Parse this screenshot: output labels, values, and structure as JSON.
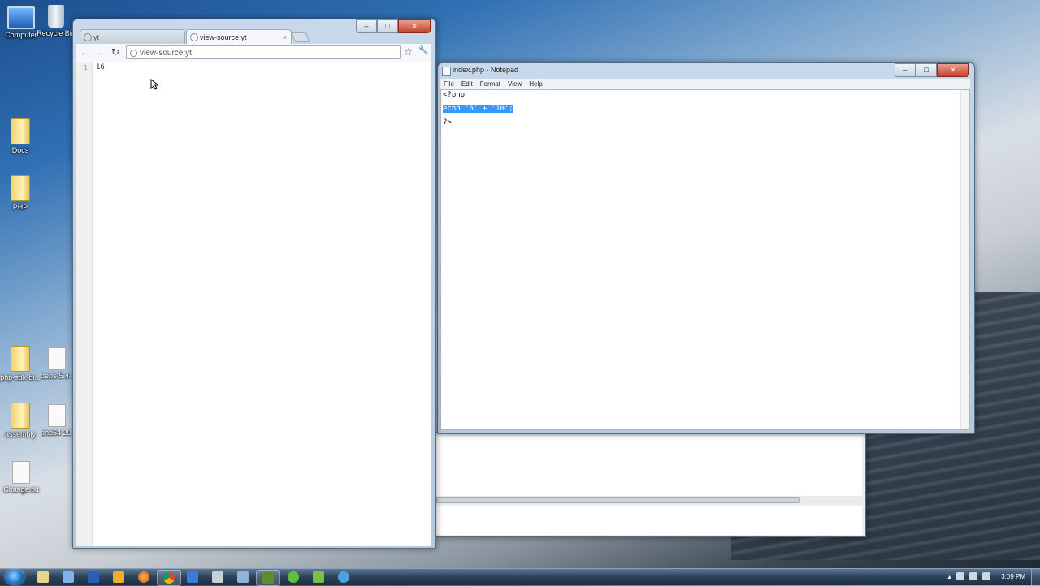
{
  "desktop": {
    "icons": [
      {
        "label": "Computer"
      },
      {
        "label": "Recycle Bin"
      },
      {
        "label": "Docs"
      },
      {
        "label": "PHP"
      },
      {
        "label": "php-sdk-bi..."
      },
      {
        "label": "deps-5.4-..."
      },
      {
        "label": "assembly"
      },
      {
        "label": "php54 20..."
      },
      {
        "label": "Change.txt"
      }
    ]
  },
  "chrome": {
    "tabs": [
      {
        "label": "yt"
      },
      {
        "label": "view-source:yt"
      }
    ],
    "close_glyph": "×",
    "address": "view-source:yt",
    "nav": {
      "back": "←",
      "forward": "→",
      "reload": "↻",
      "star": "☆",
      "wrench": "🔧"
    },
    "source": {
      "line_number": "1",
      "text": "16"
    }
  },
  "notepad": {
    "title": "index.php - Notepad",
    "menu": [
      "File",
      "Edit",
      "Format",
      "View",
      "Help"
    ],
    "lines": [
      "<?php",
      "echo '6' + '10';",
      "?>"
    ]
  },
  "window_controls": {
    "minimize": "–",
    "maximize": "□",
    "close": "✕"
  },
  "taskbar": {
    "clock": "3:09 PM",
    "tray_arrow": "▲"
  },
  "colors": {
    "selection": "#3399ff",
    "taskbar": "#2c4259",
    "close_button": "#c5422a"
  }
}
